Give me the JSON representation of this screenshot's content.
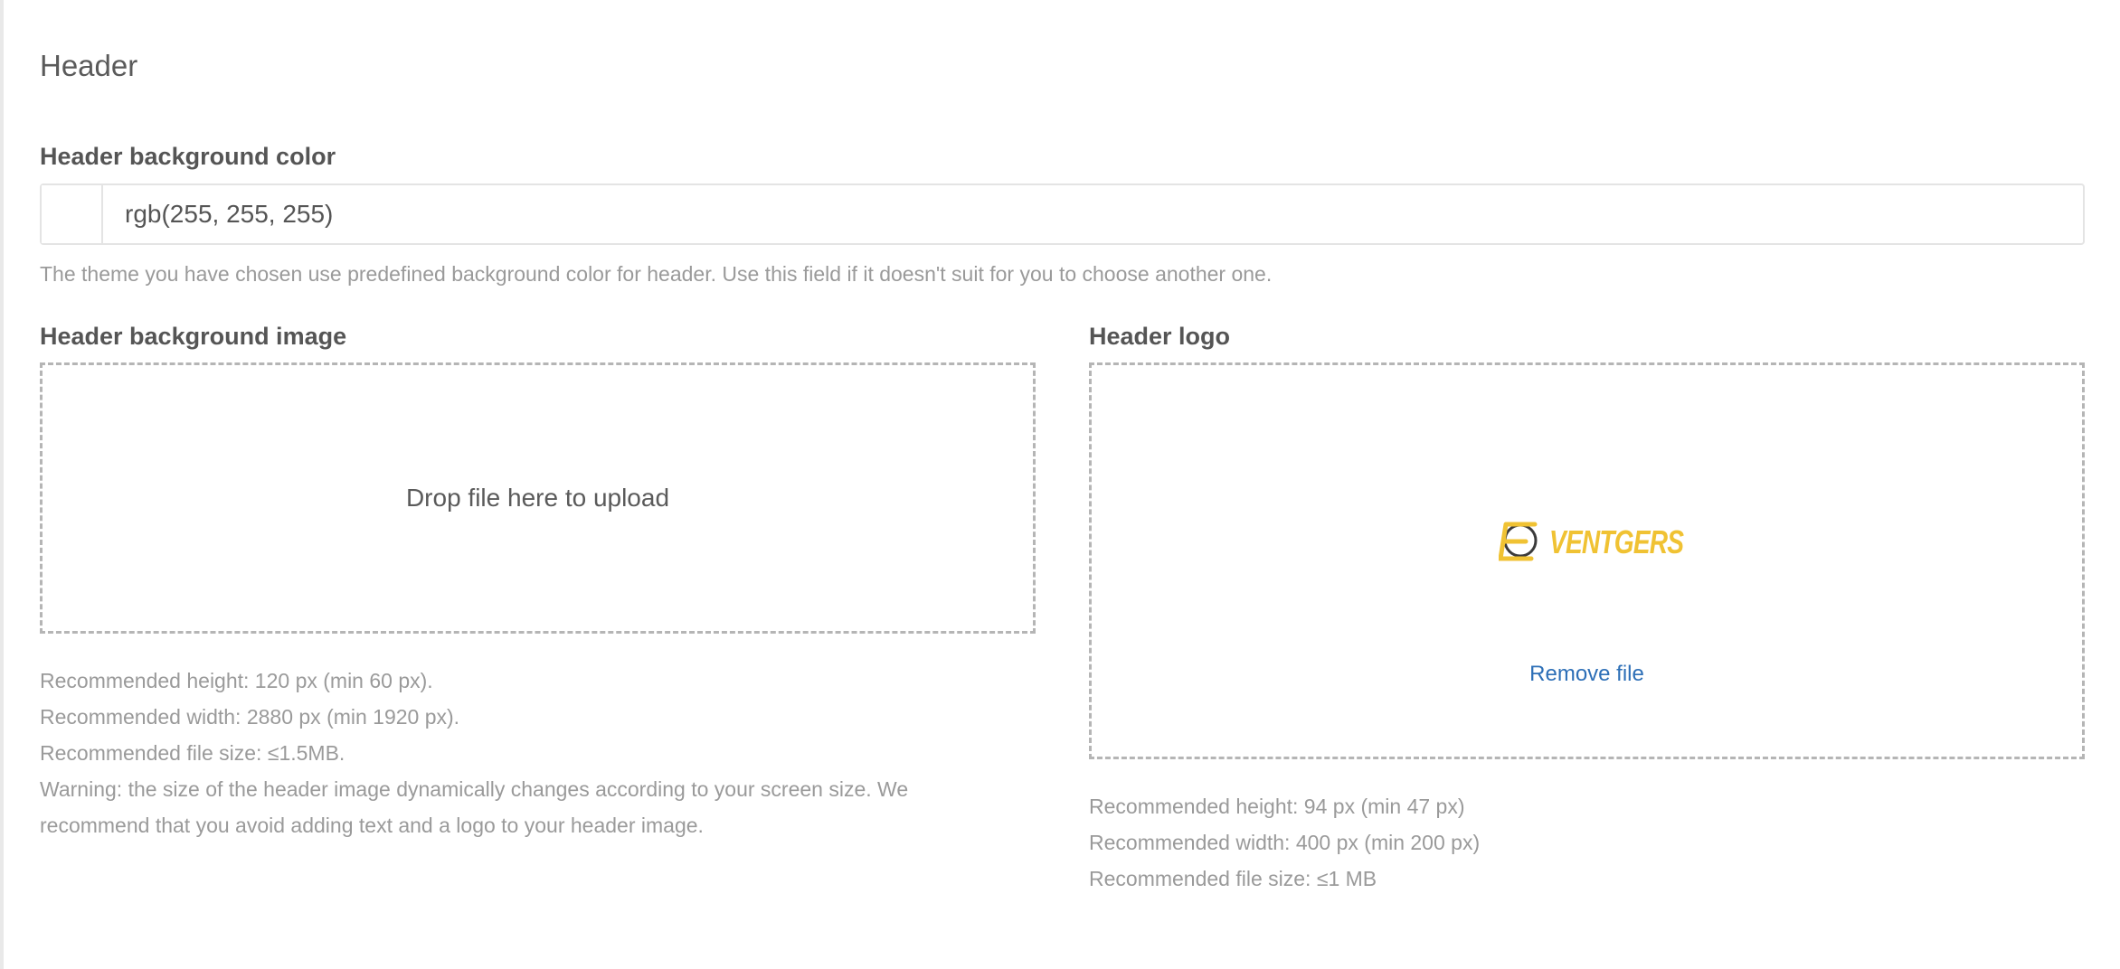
{
  "section": {
    "title": "Header"
  },
  "background_color": {
    "label": "Header background color",
    "value": "rgb(255, 255, 255)",
    "help": "The theme you have chosen use predefined background color for header. Use this field if it doesn't suit for you to choose another one."
  },
  "background_image": {
    "label": "Header background image",
    "drop_text": "Drop file here to upload",
    "notes": [
      "Recommended height: 120 px (min 60 px).",
      "Recommended width: 2880 px (min 1920 px).",
      "Recommended file size: ≤1.5MB.",
      "Warning: the size of the header image dynamically changes according to your screen size. We recommend that you avoid adding text and a logo to your header image."
    ]
  },
  "logo": {
    "label": "Header logo",
    "logo_text": "VENTGERS",
    "remove_label": "Remove file",
    "notes": [
      "Recommended height: 94 px (min 47 px)",
      "Recommended width: 400 px (min 200 px)",
      "Recommended file size: ≤1 MB"
    ]
  },
  "colors": {
    "link": "#2d6fb7",
    "logo": "#f0c233",
    "logo_dark": "#3a3a3a"
  }
}
